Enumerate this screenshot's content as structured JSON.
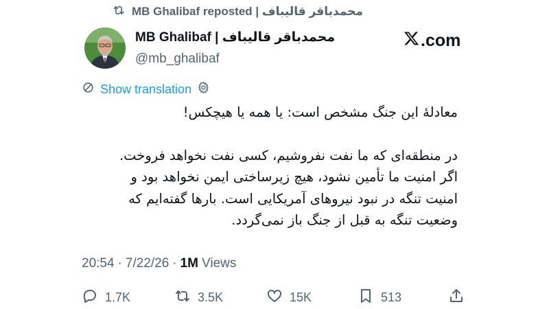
{
  "repost": {
    "label": "MB Ghalibaf reposted | محمدباقر قالیباف",
    "icon": "repost-icon"
  },
  "author": {
    "name": "MB Ghalibaf | محمدباقر قالیباف",
    "handle": "@mb_ghalibaf",
    "avatar_icon": "avatar"
  },
  "brand": {
    "label": ".com",
    "icon": "x-logo-icon"
  },
  "translation": {
    "label": "Show translation",
    "icon": "translate-icon",
    "settings_icon": "gear-icon"
  },
  "tweet": {
    "line1": "معادلهٔ این جنگ مشخص است: یا همه یا هیچکس!",
    "line2": "در منطقه‌ای که ما نفت نفروشیم، کسی نفت نخواهد فروخت.",
    "line3": "اگر امنیت ما تأمین نشود، هیچ زیرساختی ایمن نخواهد بود و",
    "line4": "امنیت تنگه در نبود نیروهای آمریکایی است. بارها گفته‌ایم که",
    "line5": "وضعیت تنگه به قبل از جنگ باز نمی‌گردد."
  },
  "meta": {
    "time": "20:54",
    "sep1": "·",
    "date": "7/22/26",
    "sep2": "·",
    "views_count": "1M",
    "views_label": "Views"
  },
  "actions": {
    "replies": "1.7K",
    "reposts": "3.5K",
    "likes": "15K",
    "bookmarks": "513"
  },
  "colors": {
    "accent": "#1d9bf0",
    "muted": "#536471",
    "text": "#0f1419"
  }
}
